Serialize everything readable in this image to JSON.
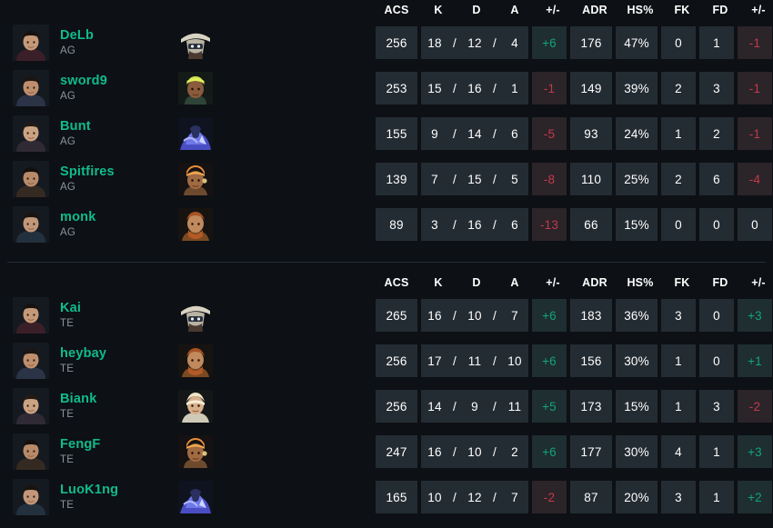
{
  "columns": [
    {
      "key": "acs",
      "label": "ACS"
    },
    {
      "key": "k",
      "label": "K"
    },
    {
      "key": "d",
      "label": "D"
    },
    {
      "key": "a",
      "label": "A"
    },
    {
      "key": "pm",
      "label": "+/-"
    },
    {
      "key": "adr",
      "label": "ADR"
    },
    {
      "key": "hs",
      "label": "HS%"
    },
    {
      "key": "fk",
      "label": "FK"
    },
    {
      "key": "fd",
      "label": "FD"
    },
    {
      "key": "pm2",
      "label": "+/-"
    }
  ],
  "colors": {
    "background": "#0d1014",
    "cell": "#242c33",
    "player_name": "#0fbc8c",
    "team_tag": "#8b949e",
    "positive": "#13a37c",
    "negative": "#c4394d",
    "positive_bg": "#1e2e31",
    "negative_bg": "#2b2429",
    "divider": "#262d36",
    "header_text": "#ffffff"
  },
  "teams": [
    {
      "tag": "AG",
      "players": [
        {
          "name": "DeLb",
          "team": "AG",
          "agent": "cypher",
          "acs": "256",
          "k": "18",
          "d": "12",
          "a": "4",
          "pm": "+6",
          "pm_sign": "pos",
          "adr": "176",
          "hs": "47%",
          "fk": "0",
          "fd": "1",
          "pm2": "-1",
          "pm2_sign": "neg"
        },
        {
          "name": "sword9",
          "team": "AG",
          "agent": "phoenix",
          "acs": "253",
          "k": "15",
          "d": "16",
          "a": "1",
          "pm": "-1",
          "pm_sign": "neg",
          "adr": "149",
          "hs": "39%",
          "fk": "2",
          "fd": "3",
          "pm2": "-1",
          "pm2_sign": "neg"
        },
        {
          "name": "Bunt",
          "team": "AG",
          "agent": "yoru",
          "acs": "155",
          "k": "9",
          "d": "14",
          "a": "6",
          "pm": "-5",
          "pm_sign": "neg",
          "adr": "93",
          "hs": "24%",
          "fk": "1",
          "fd": "2",
          "pm2": "-1",
          "pm2_sign": "neg"
        },
        {
          "name": "Spitfires",
          "team": "AG",
          "agent": "raze",
          "acs": "139",
          "k": "7",
          "d": "15",
          "a": "5",
          "pm": "-8",
          "pm_sign": "neg",
          "adr": "110",
          "hs": "25%",
          "fk": "2",
          "fd": "6",
          "pm2": "-4",
          "pm2_sign": "neg"
        },
        {
          "name": "monk",
          "team": "AG",
          "agent": "breach",
          "acs": "89",
          "k": "3",
          "d": "16",
          "a": "6",
          "pm": "-13",
          "pm_sign": "neg",
          "adr": "66",
          "hs": "15%",
          "fk": "0",
          "fd": "0",
          "pm2": "0",
          "pm2_sign": "neutral"
        }
      ]
    },
    {
      "tag": "TE",
      "players": [
        {
          "name": "Kai",
          "team": "TE",
          "agent": "cypher",
          "acs": "265",
          "k": "16",
          "d": "10",
          "a": "7",
          "pm": "+6",
          "pm_sign": "pos",
          "adr": "183",
          "hs": "36%",
          "fk": "3",
          "fd": "0",
          "pm2": "+3",
          "pm2_sign": "pos"
        },
        {
          "name": "heybay",
          "team": "TE",
          "agent": "breach",
          "acs": "256",
          "k": "17",
          "d": "11",
          "a": "10",
          "pm": "+6",
          "pm_sign": "pos",
          "adr": "156",
          "hs": "30%",
          "fk": "1",
          "fd": "0",
          "pm2": "+1",
          "pm2_sign": "pos"
        },
        {
          "name": "Biank",
          "team": "TE",
          "agent": "sova",
          "acs": "256",
          "k": "14",
          "d": "9",
          "a": "11",
          "pm": "+5",
          "pm_sign": "pos",
          "adr": "173",
          "hs": "15%",
          "fk": "1",
          "fd": "3",
          "pm2": "-2",
          "pm2_sign": "neg"
        },
        {
          "name": "FengF",
          "team": "TE",
          "agent": "raze",
          "acs": "247",
          "k": "16",
          "d": "10",
          "a": "2",
          "pm": "+6",
          "pm_sign": "pos",
          "adr": "177",
          "hs": "30%",
          "fk": "4",
          "fd": "1",
          "pm2": "+3",
          "pm2_sign": "pos"
        },
        {
          "name": "LuoK1ng",
          "team": "TE",
          "agent": "yoru",
          "acs": "165",
          "k": "10",
          "d": "12",
          "a": "7",
          "pm": "-2",
          "pm_sign": "neg",
          "adr": "87",
          "hs": "20%",
          "fk": "3",
          "fd": "1",
          "pm2": "+2",
          "pm2_sign": "pos"
        }
      ]
    }
  ]
}
